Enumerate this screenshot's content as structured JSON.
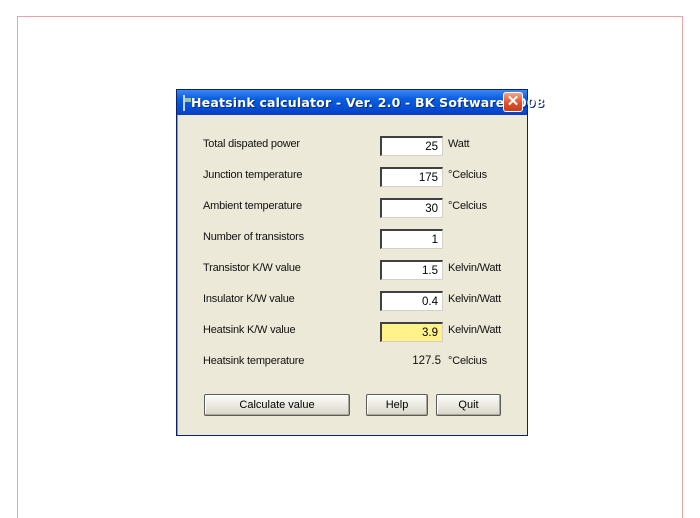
{
  "window": {
    "title": "Heatsink calculator - Ver. 2.0 - BK Software 2008",
    "close_symbol": "✕"
  },
  "rows": [
    {
      "label": "Total dispated power",
      "value": "25",
      "unit": "Watt"
    },
    {
      "label": "Junction temperature",
      "value": "175",
      "unit": "°Celcius"
    },
    {
      "label": "Ambient temperature",
      "value": "30",
      "unit": "°Celcius"
    },
    {
      "label": "Number of transistors",
      "value": "1",
      "unit": ""
    },
    {
      "label": "Transistor K/W value",
      "value": "1.5",
      "unit": "Kelvin/Watt"
    },
    {
      "label": "Insulator K/W value",
      "value": "0.4",
      "unit": "Kelvin/Watt"
    },
    {
      "label": "Heatsink K/W value",
      "value": "3.9",
      "unit": "Kelvin/Watt"
    }
  ],
  "result": {
    "label": "Heatsink temperature",
    "value": "127.5",
    "unit": "°Celcius"
  },
  "buttons": {
    "calculate": "Calculate value",
    "help": "Help",
    "quit": "Quit"
  },
  "colors": {
    "highlight_field": "#fff28a",
    "titlebar": "#0450d6",
    "window_bg": "#ece9d8"
  }
}
